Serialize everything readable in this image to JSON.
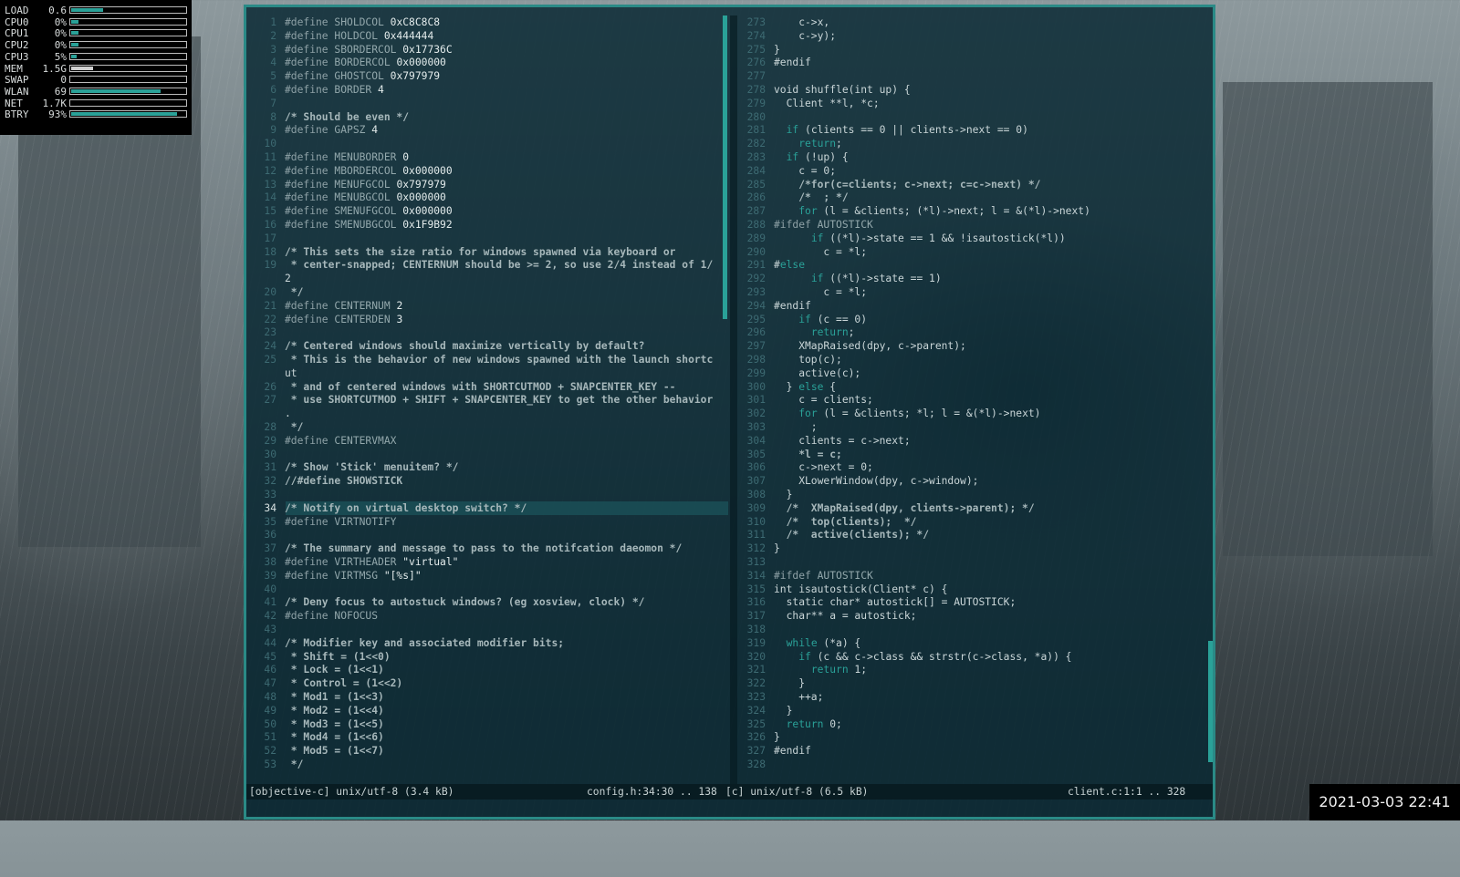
{
  "conky": [
    {
      "label": "LOAD",
      "value": "0.6",
      "level": 0.28
    },
    {
      "label": "CPU0",
      "value": "0%",
      "level": 0.06
    },
    {
      "label": "CPU1",
      "value": "0%",
      "level": 0.06
    },
    {
      "label": "CPU2",
      "value": "0%",
      "level": 0.06
    },
    {
      "label": "CPU3",
      "value": "5%",
      "level": 0.05
    },
    {
      "label": "MEM",
      "value": "1.5G",
      "level": 0.19
    },
    {
      "label": "SWAP",
      "value": "0",
      "level": 0.0
    },
    {
      "label": "WLAN",
      "value": "69",
      "level": 0.78
    },
    {
      "label": "NET",
      "value": "1.7K",
      "level": 0.0
    },
    {
      "label": "BTRY",
      "value": "93%",
      "level": 0.93
    }
  ],
  "left_pane": {
    "cursor_line": "34",
    "lines": [
      {
        "n": "1",
        "t": "#define SHOLDCOL 0xC8C8C8"
      },
      {
        "n": "2",
        "t": "#define HOLDCOL 0x444444"
      },
      {
        "n": "3",
        "t": "#define SBORDERCOL 0x17736C"
      },
      {
        "n": "4",
        "t": "#define BORDERCOL 0x000000"
      },
      {
        "n": "5",
        "t": "#define GHOSTCOL 0x797979"
      },
      {
        "n": "6",
        "t": "#define BORDER 4"
      },
      {
        "n": "7",
        "t": ""
      },
      {
        "n": "8",
        "t": "/* Should be even */"
      },
      {
        "n": "9",
        "t": "#define GAPSZ 4"
      },
      {
        "n": "10",
        "t": ""
      },
      {
        "n": "11",
        "t": "#define MENUBORDER 0"
      },
      {
        "n": "12",
        "t": "#define MBORDERCOL 0x000000"
      },
      {
        "n": "13",
        "t": "#define MENUFGCOL 0x797979"
      },
      {
        "n": "14",
        "t": "#define MENUBGCOL 0x000000"
      },
      {
        "n": "15",
        "t": "#define SMENUFGCOL 0x000000"
      },
      {
        "n": "16",
        "t": "#define SMENUBGCOL 0x1F9B92"
      },
      {
        "n": "17",
        "t": ""
      },
      {
        "n": "18",
        "t": "/* This sets the size ratio for windows spawned via keyboard or"
      },
      {
        "n": "19",
        "t": " * center-snapped; CENTERNUM should be >= 2, so use 2/4 instead of 1/"
      },
      {
        "n": "",
        "t": "2"
      },
      {
        "n": "20",
        "t": " */"
      },
      {
        "n": "21",
        "t": "#define CENTERNUM 2"
      },
      {
        "n": "22",
        "t": "#define CENTERDEN 3"
      },
      {
        "n": "23",
        "t": ""
      },
      {
        "n": "24",
        "t": "/* Centered windows should maximize vertically by default?"
      },
      {
        "n": "25",
        "t": " * This is the behavior of new windows spawned with the launch shortc"
      },
      {
        "n": "",
        "t": "ut"
      },
      {
        "n": "26",
        "t": " * and of centered windows with SHORTCUTMOD + SNAPCENTER_KEY --"
      },
      {
        "n": "27",
        "t": " * use SHORTCUTMOD + SHIFT + SNAPCENTER_KEY to get the other behavior"
      },
      {
        "n": "",
        "t": "."
      },
      {
        "n": "28",
        "t": " */"
      },
      {
        "n": "29",
        "t": "#define CENTERVMAX"
      },
      {
        "n": "30",
        "t": ""
      },
      {
        "n": "31",
        "t": "/* Show 'Stick' menuitem? */"
      },
      {
        "n": "32",
        "t": "//#define SHOWSTICK"
      },
      {
        "n": "33",
        "t": ""
      },
      {
        "n": "34",
        "t": "/* Notify on virtual desktop switch? */"
      },
      {
        "n": "35",
        "t": "#define VIRTNOTIFY"
      },
      {
        "n": "36",
        "t": ""
      },
      {
        "n": "37",
        "t": "/* The summary and message to pass to the notifcation daeomon */"
      },
      {
        "n": "38",
        "t": "#define VIRTHEADER \"virtual\""
      },
      {
        "n": "39",
        "t": "#define VIRTMSG \"[%s]\""
      },
      {
        "n": "40",
        "t": ""
      },
      {
        "n": "41",
        "t": "/* Deny focus to autostuck windows? (eg xosview, clock) */"
      },
      {
        "n": "42",
        "t": "#define NOFOCUS"
      },
      {
        "n": "43",
        "t": ""
      },
      {
        "n": "44",
        "t": "/* Modifier key and associated modifier bits;"
      },
      {
        "n": "45",
        "t": " * Shift = (1<<0)"
      },
      {
        "n": "46",
        "t": " * Lock = (1<<1)"
      },
      {
        "n": "47",
        "t": " * Control = (1<<2)"
      },
      {
        "n": "48",
        "t": " * Mod1 = (1<<3)"
      },
      {
        "n": "49",
        "t": " * Mod2 = (1<<4)"
      },
      {
        "n": "50",
        "t": " * Mod3 = (1<<5)"
      },
      {
        "n": "51",
        "t": " * Mod4 = (1<<6)"
      },
      {
        "n": "52",
        "t": " * Mod5 = (1<<7)"
      },
      {
        "n": "53",
        "t": " */"
      }
    ]
  },
  "right_pane": {
    "lines": [
      {
        "n": "273",
        "t": "    c->x,"
      },
      {
        "n": "274",
        "t": "    c->y);"
      },
      {
        "n": "275",
        "t": "}"
      },
      {
        "n": "276",
        "t": "#endif"
      },
      {
        "n": "277",
        "t": ""
      },
      {
        "n": "278",
        "t": "void shuffle(int up) {"
      },
      {
        "n": "279",
        "t": "  Client **l, *c;"
      },
      {
        "n": "280",
        "t": ""
      },
      {
        "n": "281",
        "t": "  if (clients == 0 || clients->next == 0)"
      },
      {
        "n": "282",
        "t": "    return;"
      },
      {
        "n": "283",
        "t": "  if (!up) {"
      },
      {
        "n": "284",
        "t": "    c = 0;"
      },
      {
        "n": "285",
        "t": "    /*for(c=clients; c->next; c=c->next) */"
      },
      {
        "n": "286",
        "t": "    /*  ; */"
      },
      {
        "n": "287",
        "t": "    for (l = &clients; (*l)->next; l = &(*l)->next)"
      },
      {
        "n": "288",
        "t": "#ifdef AUTOSTICK"
      },
      {
        "n": "289",
        "t": "      if ((*l)->state == 1 && !isautostick(*l))"
      },
      {
        "n": "290",
        "t": "        c = *l;"
      },
      {
        "n": "291",
        "t": "#else"
      },
      {
        "n": "292",
        "t": "      if ((*l)->state == 1)"
      },
      {
        "n": "293",
        "t": "        c = *l;"
      },
      {
        "n": "294",
        "t": "#endif"
      },
      {
        "n": "295",
        "t": "    if (c == 0)"
      },
      {
        "n": "296",
        "t": "      return;"
      },
      {
        "n": "297",
        "t": "    XMapRaised(dpy, c->parent);"
      },
      {
        "n": "298",
        "t": "    top(c);"
      },
      {
        "n": "299",
        "t": "    active(c);"
      },
      {
        "n": "300",
        "t": "  } else {"
      },
      {
        "n": "301",
        "t": "    c = clients;"
      },
      {
        "n": "302",
        "t": "    for (l = &clients; *l; l = &(*l)->next)"
      },
      {
        "n": "303",
        "t": "      ;"
      },
      {
        "n": "304",
        "t": "    clients = c->next;"
      },
      {
        "n": "305",
        "t": "    *l = c;"
      },
      {
        "n": "306",
        "t": "    c->next = 0;"
      },
      {
        "n": "307",
        "t": "    XLowerWindow(dpy, c->window);"
      },
      {
        "n": "308",
        "t": "  }"
      },
      {
        "n": "309",
        "t": "  /*  XMapRaised(dpy, clients->parent); */"
      },
      {
        "n": "310",
        "t": "  /*  top(clients);  */"
      },
      {
        "n": "311",
        "t": "  /*  active(clients); */"
      },
      {
        "n": "312",
        "t": "}"
      },
      {
        "n": "313",
        "t": ""
      },
      {
        "n": "314",
        "t": "#ifdef AUTOSTICK"
      },
      {
        "n": "315",
        "t": "int isautostick(Client* c) {"
      },
      {
        "n": "316",
        "t": "  static char* autostick[] = AUTOSTICK;"
      },
      {
        "n": "317",
        "t": "  char** a = autostick;"
      },
      {
        "n": "318",
        "t": ""
      },
      {
        "n": "319",
        "t": "  while (*a) {"
      },
      {
        "n": "320",
        "t": "    if (c && c->class && strstr(c->class, *a)) {"
      },
      {
        "n": "321",
        "t": "      return 1;"
      },
      {
        "n": "322",
        "t": "    }"
      },
      {
        "n": "323",
        "t": "    ++a;"
      },
      {
        "n": "324",
        "t": "  }"
      },
      {
        "n": "325",
        "t": "  return 0;"
      },
      {
        "n": "326",
        "t": "}"
      },
      {
        "n": "327",
        "t": "#endif"
      },
      {
        "n": "328",
        "t": ""
      }
    ]
  },
  "status": {
    "left_mode": "[objective-c] unix/utf-8 (3.4 kB)",
    "left_pos": "config.h:34:30 .. 138",
    "right_mode": "[c] unix/utf-8 (6.5 kB)",
    "right_pos": "client.c:1:1 .. 328"
  },
  "clock": "2021-03-03 22:41",
  "colors": {
    "accent": "#2aa198",
    "border": "#2a8a86",
    "editor_bg": "#0b2a34"
  }
}
